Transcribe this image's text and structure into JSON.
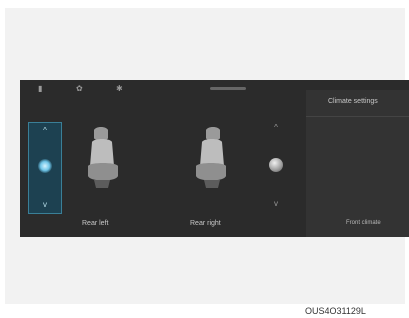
{
  "topbar": {
    "icons": [
      "seat-heat-icon",
      "settings-icon",
      "fan-icon"
    ]
  },
  "left_control": {
    "up": "^",
    "down": "v"
  },
  "seats": {
    "left_label": "Rear left",
    "right_label": "Rear right"
  },
  "right_control": {
    "up": "^",
    "down": "v"
  },
  "side_panel": {
    "title": "Climate settings",
    "footer": "Front climate"
  },
  "caption": "OUS4O31129L",
  "colors": {
    "screen_bg": "#2b2b2b",
    "panel_bg": "#333333",
    "active_control": "#1d4151",
    "active_accent": "#6fc5e8"
  }
}
